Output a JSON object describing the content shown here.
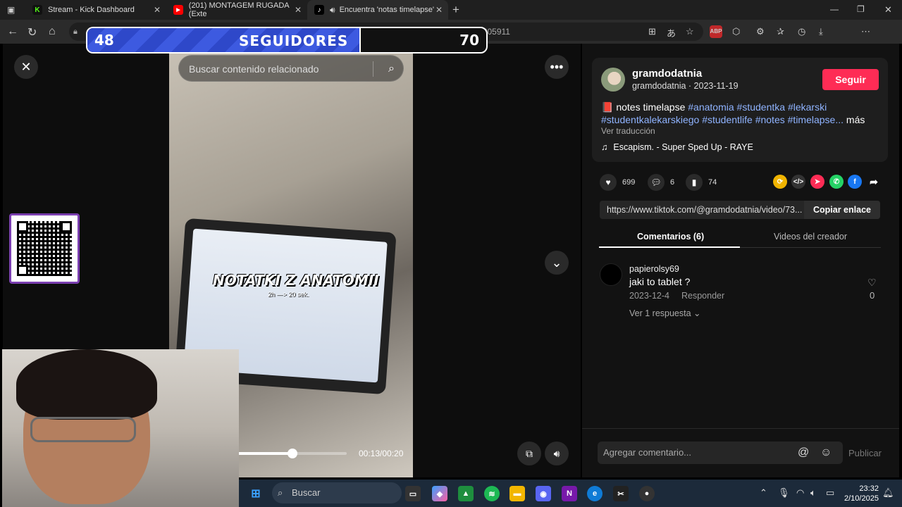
{
  "browser": {
    "tabs": [
      {
        "title": "Stream - Kick Dashboard",
        "icon": "K",
        "icon_color": "#53fc18"
      },
      {
        "title": "(201) MONTAGEM RUGADA (Exte",
        "icon": "▶",
        "icon_color": "#ff0000"
      },
      {
        "title": "Encuentra 'notas timelapse'",
        "icon": "♪",
        "icon_color": "#000000"
      }
    ],
    "url": "=notas%20timelapse&t=1759465805911"
  },
  "overlay": {
    "followers_current": "48",
    "followers_label": "SEGUIDORES",
    "followers_goal": "70",
    "progress_fraction": 0.686
  },
  "video": {
    "search_placeholder": "Buscar contenido relacionado",
    "overlay_title": "NOTATKI Z ANATOMII",
    "overlay_sub": "2h —> 20 sek.",
    "time": "00:13/00:20",
    "progress_fraction": 0.5
  },
  "post": {
    "username": "gramdodatnia",
    "handle_date": "gramdodatnia · 2023-11-19",
    "follow_label": "Seguir",
    "desc_prefix": "📕 notes timelapse ",
    "tags": [
      "#anatomia",
      "#studentka",
      "#lekarski",
      "#studentkalekarskiego",
      "#studentlife",
      "#notes",
      "#timelapse..."
    ],
    "more_label": "más",
    "translate_label": "Ver traducción",
    "music": "Escapism. - Super Sped Up - RAYE",
    "likes": "699",
    "comments": "6",
    "saves": "74",
    "link": "https://www.tiktok.com/@gramdodatnia/video/73...",
    "copy_label": "Copiar enlace",
    "tab_comments": "Comentarios (6)",
    "tab_creator": "Videos del creador"
  },
  "comment": {
    "user": "papierolsy69",
    "text": "jaki to tablet ?",
    "date": "2023-12-4",
    "reply_label": "Responder",
    "more_replies": "Ver 1 respuesta",
    "likes": "0"
  },
  "comment_box": {
    "placeholder": "Agregar comentario...",
    "publish_label": "Publicar"
  },
  "taskbar": {
    "search_label": "Buscar",
    "time": "23:32",
    "date": "2/10/2025"
  }
}
